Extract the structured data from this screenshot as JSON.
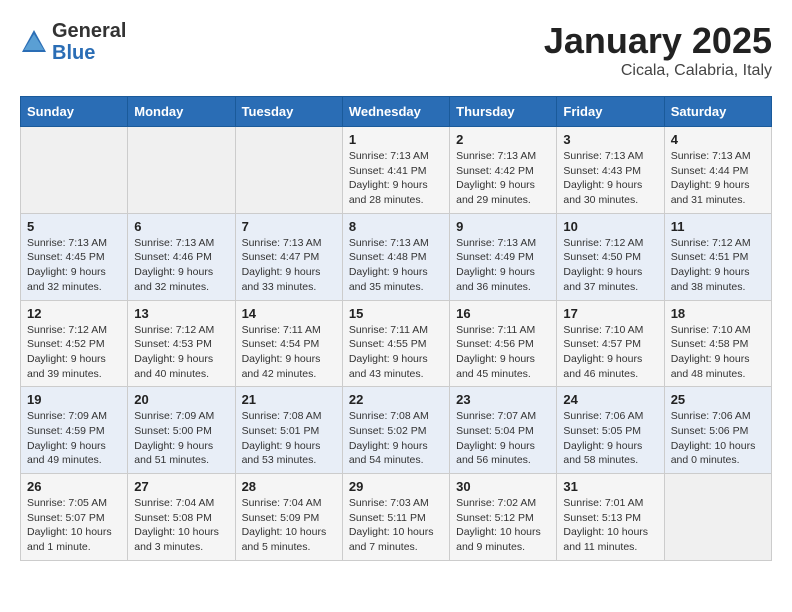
{
  "header": {
    "logo": {
      "general": "General",
      "blue": "Blue"
    },
    "title": "January 2025",
    "subtitle": "Cicala, Calabria, Italy"
  },
  "weekdays": [
    "Sunday",
    "Monday",
    "Tuesday",
    "Wednesday",
    "Thursday",
    "Friday",
    "Saturday"
  ],
  "weeks": [
    [
      {
        "day": "",
        "text": ""
      },
      {
        "day": "",
        "text": ""
      },
      {
        "day": "",
        "text": ""
      },
      {
        "day": "1",
        "text": "Sunrise: 7:13 AM\nSunset: 4:41 PM\nDaylight: 9 hours and 28 minutes."
      },
      {
        "day": "2",
        "text": "Sunrise: 7:13 AM\nSunset: 4:42 PM\nDaylight: 9 hours and 29 minutes."
      },
      {
        "day": "3",
        "text": "Sunrise: 7:13 AM\nSunset: 4:43 PM\nDaylight: 9 hours and 30 minutes."
      },
      {
        "day": "4",
        "text": "Sunrise: 7:13 AM\nSunset: 4:44 PM\nDaylight: 9 hours and 31 minutes."
      }
    ],
    [
      {
        "day": "5",
        "text": "Sunrise: 7:13 AM\nSunset: 4:45 PM\nDaylight: 9 hours and 32 minutes."
      },
      {
        "day": "6",
        "text": "Sunrise: 7:13 AM\nSunset: 4:46 PM\nDaylight: 9 hours and 32 minutes."
      },
      {
        "day": "7",
        "text": "Sunrise: 7:13 AM\nSunset: 4:47 PM\nDaylight: 9 hours and 33 minutes."
      },
      {
        "day": "8",
        "text": "Sunrise: 7:13 AM\nSunset: 4:48 PM\nDaylight: 9 hours and 35 minutes."
      },
      {
        "day": "9",
        "text": "Sunrise: 7:13 AM\nSunset: 4:49 PM\nDaylight: 9 hours and 36 minutes."
      },
      {
        "day": "10",
        "text": "Sunrise: 7:12 AM\nSunset: 4:50 PM\nDaylight: 9 hours and 37 minutes."
      },
      {
        "day": "11",
        "text": "Sunrise: 7:12 AM\nSunset: 4:51 PM\nDaylight: 9 hours and 38 minutes."
      }
    ],
    [
      {
        "day": "12",
        "text": "Sunrise: 7:12 AM\nSunset: 4:52 PM\nDaylight: 9 hours and 39 minutes."
      },
      {
        "day": "13",
        "text": "Sunrise: 7:12 AM\nSunset: 4:53 PM\nDaylight: 9 hours and 40 minutes."
      },
      {
        "day": "14",
        "text": "Sunrise: 7:11 AM\nSunset: 4:54 PM\nDaylight: 9 hours and 42 minutes."
      },
      {
        "day": "15",
        "text": "Sunrise: 7:11 AM\nSunset: 4:55 PM\nDaylight: 9 hours and 43 minutes."
      },
      {
        "day": "16",
        "text": "Sunrise: 7:11 AM\nSunset: 4:56 PM\nDaylight: 9 hours and 45 minutes."
      },
      {
        "day": "17",
        "text": "Sunrise: 7:10 AM\nSunset: 4:57 PM\nDaylight: 9 hours and 46 minutes."
      },
      {
        "day": "18",
        "text": "Sunrise: 7:10 AM\nSunset: 4:58 PM\nDaylight: 9 hours and 48 minutes."
      }
    ],
    [
      {
        "day": "19",
        "text": "Sunrise: 7:09 AM\nSunset: 4:59 PM\nDaylight: 9 hours and 49 minutes."
      },
      {
        "day": "20",
        "text": "Sunrise: 7:09 AM\nSunset: 5:00 PM\nDaylight: 9 hours and 51 minutes."
      },
      {
        "day": "21",
        "text": "Sunrise: 7:08 AM\nSunset: 5:01 PM\nDaylight: 9 hours and 53 minutes."
      },
      {
        "day": "22",
        "text": "Sunrise: 7:08 AM\nSunset: 5:02 PM\nDaylight: 9 hours and 54 minutes."
      },
      {
        "day": "23",
        "text": "Sunrise: 7:07 AM\nSunset: 5:04 PM\nDaylight: 9 hours and 56 minutes."
      },
      {
        "day": "24",
        "text": "Sunrise: 7:06 AM\nSunset: 5:05 PM\nDaylight: 9 hours and 58 minutes."
      },
      {
        "day": "25",
        "text": "Sunrise: 7:06 AM\nSunset: 5:06 PM\nDaylight: 10 hours and 0 minutes."
      }
    ],
    [
      {
        "day": "26",
        "text": "Sunrise: 7:05 AM\nSunset: 5:07 PM\nDaylight: 10 hours and 1 minute."
      },
      {
        "day": "27",
        "text": "Sunrise: 7:04 AM\nSunset: 5:08 PM\nDaylight: 10 hours and 3 minutes."
      },
      {
        "day": "28",
        "text": "Sunrise: 7:04 AM\nSunset: 5:09 PM\nDaylight: 10 hours and 5 minutes."
      },
      {
        "day": "29",
        "text": "Sunrise: 7:03 AM\nSunset: 5:11 PM\nDaylight: 10 hours and 7 minutes."
      },
      {
        "day": "30",
        "text": "Sunrise: 7:02 AM\nSunset: 5:12 PM\nDaylight: 10 hours and 9 minutes."
      },
      {
        "day": "31",
        "text": "Sunrise: 7:01 AM\nSunset: 5:13 PM\nDaylight: 10 hours and 11 minutes."
      },
      {
        "day": "",
        "text": ""
      }
    ]
  ]
}
